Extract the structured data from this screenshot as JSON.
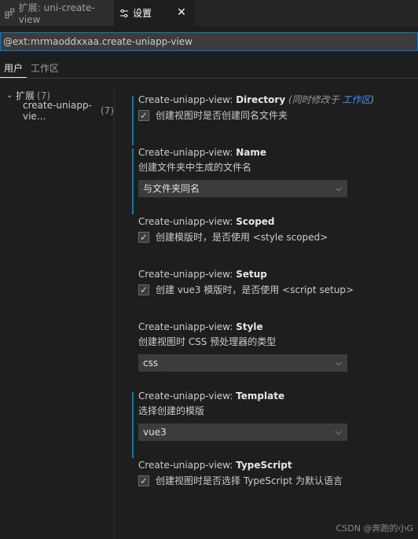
{
  "tabs": [
    {
      "label": "扩展: uni-create-view",
      "icon": "extensions-icon"
    },
    {
      "label": "设置",
      "icon": "settings-icon",
      "active": true
    }
  ],
  "search": {
    "value": "@ext:mrmaoddxxaa.create-uniapp-view"
  },
  "scope_tabs": [
    {
      "label": "用户",
      "active": true
    },
    {
      "label": "工作区"
    }
  ],
  "toc": {
    "root_label": "扩展",
    "root_count": "(7)",
    "child_label": "create-uniapp-vie...",
    "child_count": "(7)"
  },
  "settings": [
    {
      "prefix": "Create-uniapp-view: ",
      "name": "Directory",
      "italic": "(同时修改于 ",
      "link": "工作区",
      "italic_end": ")",
      "type": "checkbox",
      "checked": true,
      "desc": "创建视图时是否创建同名文件夹",
      "modified": true
    },
    {
      "prefix": "Create-uniapp-view: ",
      "name": "Name",
      "type": "select",
      "desc": "创建文件夹中生成的文件名",
      "value": "与文件夹同名",
      "modified": true
    },
    {
      "prefix": "Create-uniapp-view: ",
      "name": "Scoped",
      "type": "checkbox",
      "checked": true,
      "desc": "创建模版时，是否使用 <style scoped>"
    },
    {
      "prefix": "Create-uniapp-view: ",
      "name": "Setup",
      "type": "checkbox",
      "checked": true,
      "desc": "创建 vue3 模版时，是否使用 <script setup>"
    },
    {
      "prefix": "Create-uniapp-view: ",
      "name": "Style",
      "type": "select",
      "desc": "创建视图时 CSS 预处理器的类型",
      "value": "css"
    },
    {
      "prefix": "Create-uniapp-view: ",
      "name": "Template",
      "type": "select",
      "desc": "选择创建的模版",
      "value": "vue3",
      "modified": true
    },
    {
      "prefix": "Create-uniapp-view: ",
      "name": "TypeScript",
      "type": "checkbox",
      "checked": true,
      "desc": "创建视图时是否选择 TypeScript 为默认语言"
    }
  ],
  "watermark": "CSDN @奔跑的小G",
  "colors": {
    "accent": "#007fd4",
    "modified_bar": "#0c7d9d",
    "link": "#3794ff"
  }
}
